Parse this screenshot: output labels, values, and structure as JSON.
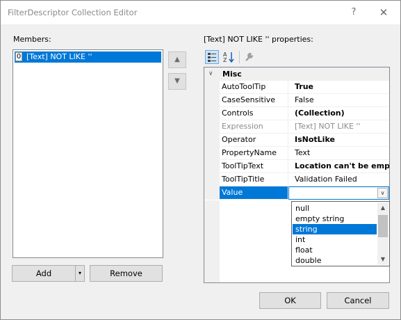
{
  "window": {
    "title": "FilterDescriptor Collection Editor",
    "help": "?",
    "close": "✕"
  },
  "members": {
    "label": "Members:",
    "items": [
      {
        "index": "0",
        "text": "[Text] NOT LIKE ''"
      }
    ],
    "move_up_glyph": "▲",
    "move_down_glyph": "▼",
    "add_label": "Add",
    "add_dropdown_glyph": "▾",
    "remove_label": "Remove"
  },
  "properties": {
    "label": "[Text] NOT LIKE '' properties:",
    "category": {
      "name": "Misc",
      "toggle": "∨"
    },
    "rows": [
      {
        "name": "AutoToolTip",
        "value": "True",
        "bold": true,
        "gray": false
      },
      {
        "name": "CaseSensitive",
        "value": "False",
        "bold": false,
        "gray": false
      },
      {
        "name": "Controls",
        "value": "(Collection)",
        "bold": true,
        "gray": false
      },
      {
        "name": "Expression",
        "value": "[Text] NOT LIKE ''",
        "bold": false,
        "gray": true
      },
      {
        "name": "Operator",
        "value": "IsNotLike",
        "bold": true,
        "gray": false
      },
      {
        "name": "PropertyName",
        "value": "Text",
        "bold": false,
        "gray": false
      },
      {
        "name": "ToolTipText",
        "value": "Location can't be empty!",
        "bold": true,
        "gray": false
      },
      {
        "name": "ToolTipTitle",
        "value": "Validation Failed",
        "bold": false,
        "gray": false
      }
    ],
    "selected_row": {
      "name": "Value",
      "value": "",
      "combo_glyph": "∨"
    },
    "dropdown_options": [
      "null",
      "empty string",
      "string",
      "int",
      "float",
      "double"
    ],
    "dropdown_selected": "string"
  },
  "footer": {
    "ok_label": "OK",
    "cancel_label": "Cancel"
  },
  "colors": {
    "selection": "#0078d7",
    "dialog_bg": "#f0f0f0"
  }
}
